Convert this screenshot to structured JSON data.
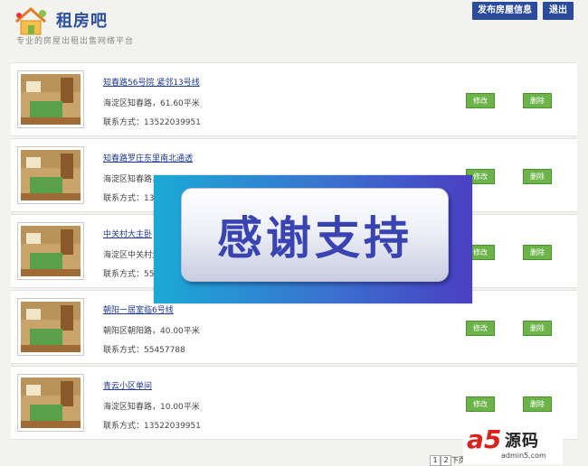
{
  "header": {
    "logo_icon": "house-icon",
    "title": "租房吧",
    "subtitle": "专业的房屋出租出售网络平台",
    "publish_label": "发布房屋信息",
    "logout_label": "退出"
  },
  "listings": [
    {
      "title": "知春路56号院 紧邻13号线",
      "location": "海淀区知春路，61.60平米",
      "phone": "联系方式：13522039951",
      "edit_label": "修改",
      "delete_label": "删除"
    },
    {
      "title": "知春路罗庄东里南北通透",
      "location": "海淀区知春路，",
      "phone": "联系方式：13",
      "edit_label": "修改",
      "delete_label": "删除"
    },
    {
      "title": "中关村大主卧",
      "location": "海淀区中关村大",
      "phone": "联系方式：554",
      "edit_label": "修改",
      "delete_label": "删除"
    },
    {
      "title": "朝阳一居室临6号线",
      "location": "朝阳区朝阳路，40.00平米",
      "phone": "联系方式：55457788",
      "edit_label": "修改",
      "delete_label": "删除"
    },
    {
      "title": "青云小区单间",
      "location": "海淀区知春路，10.00平米",
      "phone": "联系方式：13522039951",
      "edit_label": "修改",
      "delete_label": "删除"
    }
  ],
  "overlay": {
    "text": "感谢支持"
  },
  "pagination": {
    "pages": [
      "1",
      "2"
    ],
    "next_label": "下页"
  },
  "watermark": {
    "text": "源码",
    "url": "admin5.com"
  },
  "colors": {
    "brand": "#2b4b9c",
    "action_green": "#6cb349",
    "banner_blue": "#3a72cf"
  }
}
